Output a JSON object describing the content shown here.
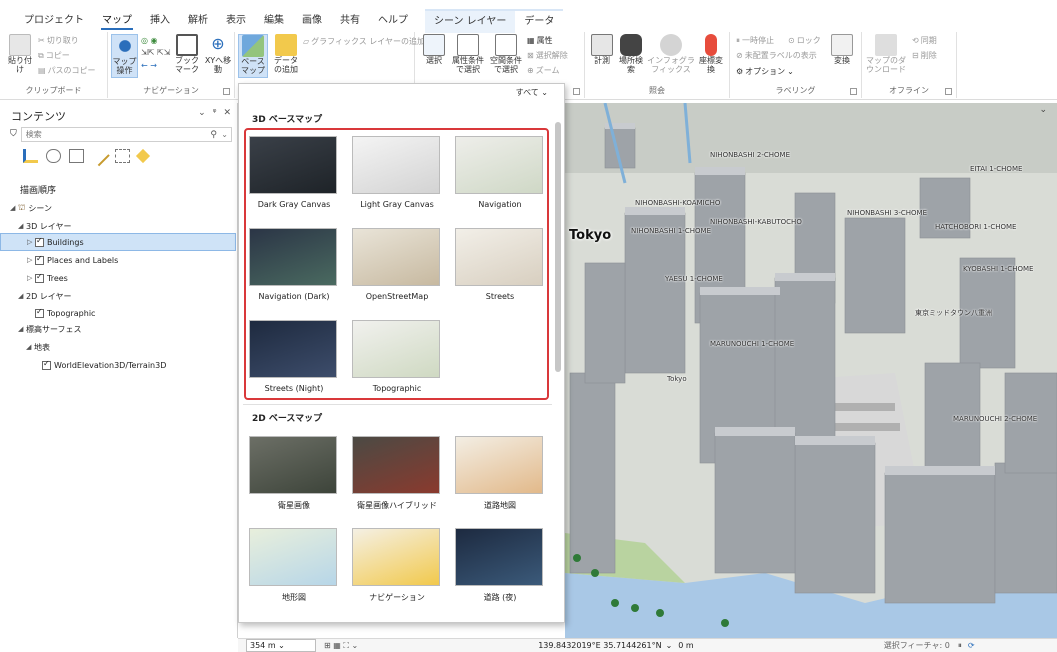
{
  "tabs": [
    "プロジェクト",
    "マップ",
    "挿入",
    "解析",
    "表示",
    "編集",
    "画像",
    "共有",
    "ヘルプ"
  ],
  "context_tabs": [
    "シーン レイヤー",
    "データ"
  ],
  "ribbon": {
    "clipboard": {
      "paste": "貼り付け",
      "cut": "切り取り",
      "copy": "コピー",
      "copy_path": "パスのコピー",
      "label": "クリップボード"
    },
    "navigation": {
      "explore": "マップ操作",
      "bookmarks": "ブックマーク",
      "goto_xy": "XYへ移動",
      "label": "ナビゲーション"
    },
    "layer": {
      "basemap": "ベースマップ",
      "add_data": "データの追加",
      "add_graphics": "グラフィックス レイヤーの追加"
    },
    "selection": {
      "select": "選択",
      "by_attr": "属性条件で選択",
      "by_loc": "空間条件で選択",
      "attributes": "属性",
      "clear": "選択解除",
      "zoom": "ズーム"
    },
    "inquiry": {
      "measure": "計測",
      "locate": "場所検索",
      "infographics": "インフォグラフィックス",
      "convert": "座標変換",
      "label": "照会"
    },
    "labeling": {
      "pause": "一時停止",
      "lock": "ロック",
      "unplaced": "未配置ラベルの表示",
      "options": "オプション",
      "convert": "変換",
      "label": "ラベリング"
    },
    "offline": {
      "download": "マップのダウンロード",
      "sync": "同期",
      "remove": "削除",
      "label": "オフライン"
    }
  },
  "contents": {
    "title": "コンテンツ",
    "search_placeholder": "検索",
    "draw_order": "描画順序",
    "scene": "シーン",
    "layers_3d": "3D レイヤー",
    "buildings": "Buildings",
    "places": "Places and Labels",
    "trees": "Trees",
    "layers_2d": "2D レイヤー",
    "topographic": "Topographic",
    "elevation": "標高サーフェス",
    "ground": "地表",
    "terrain": "WorldElevation3D/Terrain3D"
  },
  "gallery": {
    "filter": "すべて",
    "head_3d": "3D ベースマップ",
    "head_2d": "2D ベースマップ",
    "tiles_3d": [
      "Dark Gray Canvas",
      "Light Gray Canvas",
      "Navigation",
      "Navigation (Dark)",
      "OpenStreetMap",
      "Streets",
      "Streets (Night)",
      "Topographic"
    ],
    "tiles_2d": [
      "衛星画像",
      "衛星画像ハイブリッド",
      "道路地図",
      "地形図",
      "ナビゲーション",
      "道路 (夜)"
    ]
  },
  "map": {
    "city": "Tokyo",
    "labels": [
      "NIHONBASHI 2-CHOME",
      "EITAI 1-CHOME",
      "NIHONBASHI-KOAMICHO",
      "NIHONBASHI-KABUTOCHO",
      "NIHONBASHI 1-CHOME",
      "NIHONBASHI 3-CHOME",
      "HATCHOBORI 1-CHOME",
      "YAESU 1-CHOME",
      "KYOBASHI 1-CHOME",
      "MARUNOUCHI 1-CHOME",
      "MARUNOUCHI 2-CHOME",
      "東京ミッドタウン八重洲",
      "Tokyo"
    ]
  },
  "status": {
    "scale": "354 m",
    "coords": "139.8432019°E 35.7144261°N",
    "elev": "0 m",
    "selected": "選択フィーチャ: 0"
  }
}
